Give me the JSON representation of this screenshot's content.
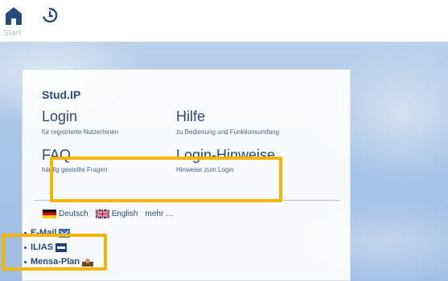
{
  "topbar": {
    "start_label": "Start"
  },
  "card": {
    "title": "Stud.IP",
    "links": [
      {
        "title": "Login",
        "subtitle": "für registrierte NutzerInnen"
      },
      {
        "title": "Hilfe",
        "subtitle": "zu Bedienung und Funktionsumfang"
      },
      {
        "title": "FAQ",
        "subtitle": "häufig gestellte Fragen"
      },
      {
        "title": "Login-Hinweise",
        "subtitle": "Hinweise zum Login"
      }
    ],
    "languages": [
      {
        "label": "Deutsch",
        "flag": "de-flag-icon"
      },
      {
        "label": "English",
        "flag": "uk-flag-icon"
      }
    ],
    "more_label": "mehr …"
  },
  "quick_links": [
    {
      "label": "E-Mail",
      "icon": "mail-badge-icon"
    },
    {
      "label": "ILIAS",
      "icon": "ilias-badge-icon"
    },
    {
      "label": "Mensa-Plan",
      "icon": "mensa-badge-icon"
    }
  ],
  "colors": {
    "accent": "#28497c",
    "highlight": "#f7b500"
  }
}
